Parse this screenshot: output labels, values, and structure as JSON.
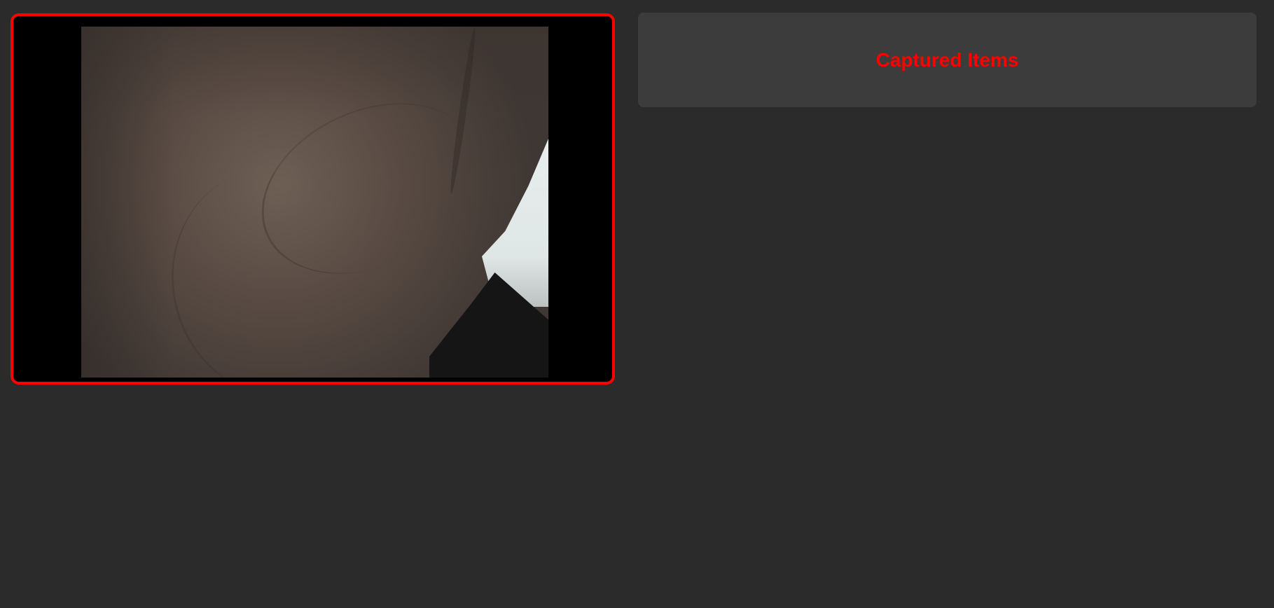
{
  "camera": {
    "accent_color": "#ff0000"
  },
  "captured_panel": {
    "title": "Captured Items",
    "title_color": "#ff0000"
  }
}
